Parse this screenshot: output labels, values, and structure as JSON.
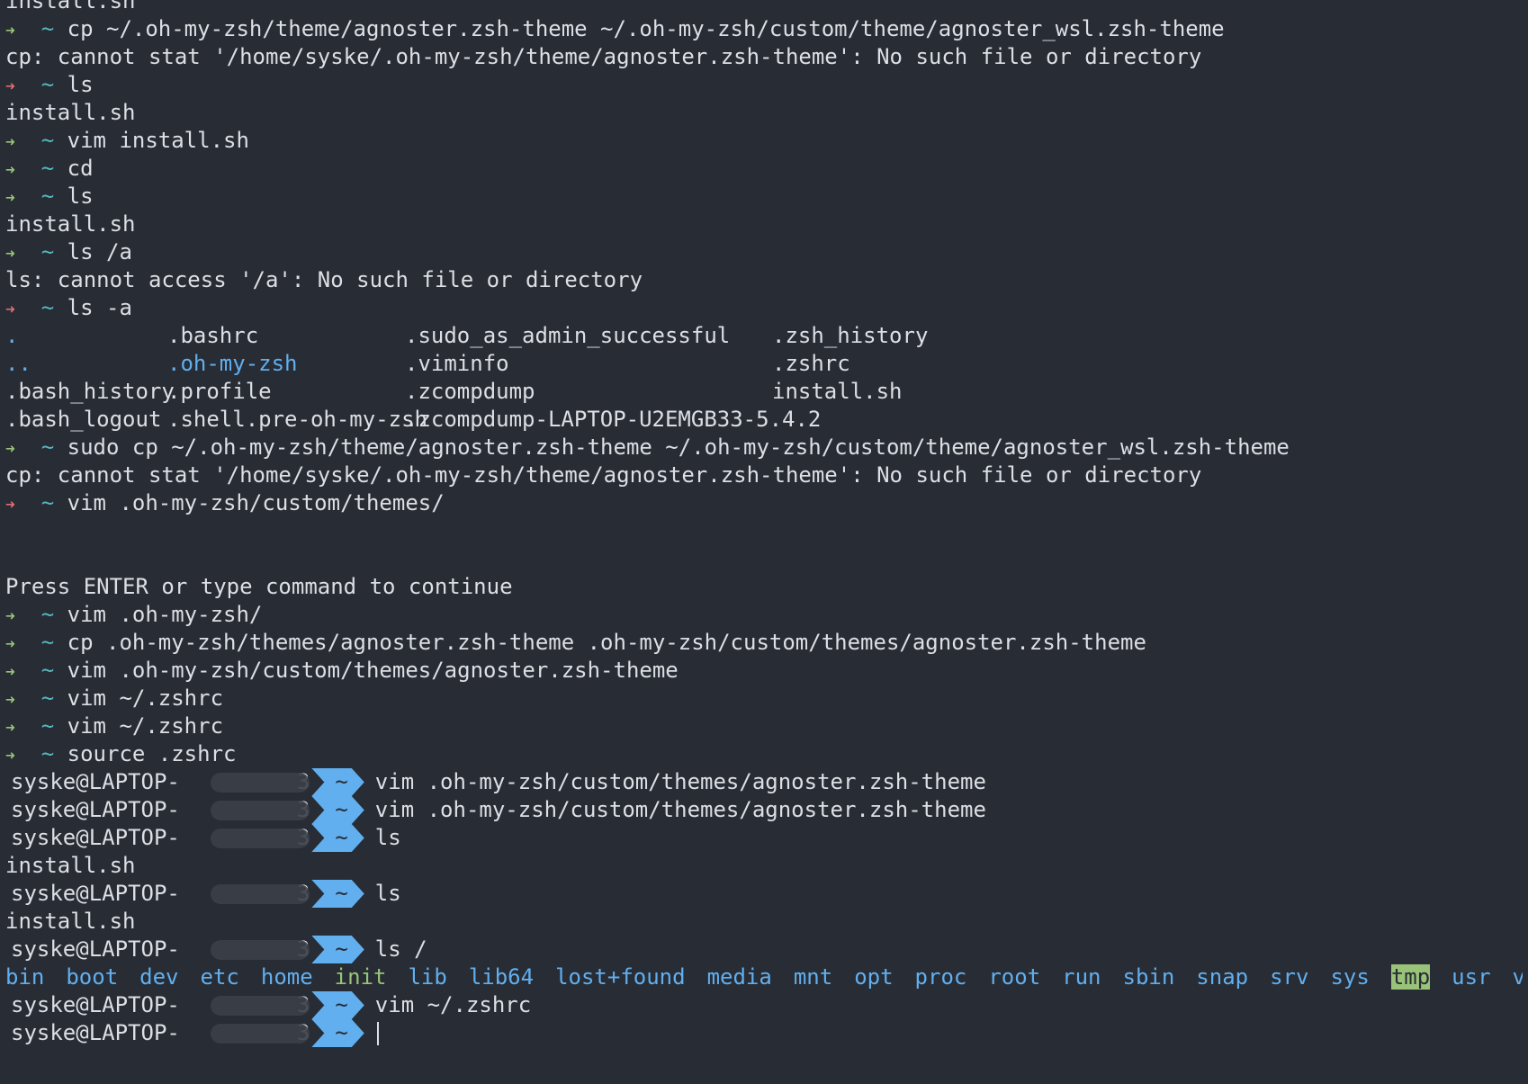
{
  "partial_top": "install.sh",
  "zsh_lines": [
    {
      "status": "ok",
      "cmd": "cp ~/.oh-my-zsh/theme/agnoster.zsh-theme ~/.oh-my-zsh/custom/theme/agnoster_wsl.zsh-theme"
    },
    {
      "out": "cp: cannot stat '/home/syske/.oh-my-zsh/theme/agnoster.zsh-theme': No such file or directory"
    },
    {
      "status": "err",
      "cmd": "ls"
    },
    {
      "out": "install.sh"
    },
    {
      "status": "ok",
      "cmd": "vim install.sh"
    },
    {
      "status": "ok",
      "cmd": "cd"
    },
    {
      "status": "ok",
      "cmd": "ls"
    },
    {
      "out": "install.sh"
    },
    {
      "status": "ok",
      "cmd": "ls /a"
    },
    {
      "out": "ls: cannot access '/a': No such file or directory"
    },
    {
      "status": "err",
      "cmd": "ls -a"
    }
  ],
  "ls_a": [
    [
      {
        "t": ".",
        "c": "dir"
      },
      {
        "t": ".bashrc"
      },
      {
        "t": ".sudo_as_admin_successful"
      },
      {
        "t": ".zsh_history"
      }
    ],
    [
      {
        "t": "..",
        "c": "dir"
      },
      {
        "t": ".oh-my-zsh",
        "c": "dir"
      },
      {
        "t": ".viminfo"
      },
      {
        "t": ".zshrc"
      }
    ],
    [
      {
        "t": ".bash_history"
      },
      {
        "t": ".profile"
      },
      {
        "t": ".zcompdump"
      },
      {
        "t": "install.sh"
      }
    ],
    [
      {
        "t": ".bash_logout"
      },
      {
        "t": ".shell.pre-oh-my-zsh"
      },
      {
        "t": ".zcompdump-LAPTOP-U2EMGB33-5.4.2"
      },
      {
        "t": ""
      }
    ]
  ],
  "zsh_lines2": [
    {
      "status": "ok",
      "cmd": "sudo cp ~/.oh-my-zsh/theme/agnoster.zsh-theme ~/.oh-my-zsh/custom/theme/agnoster_wsl.zsh-theme"
    },
    {
      "out": "cp: cannot stat '/home/syske/.oh-my-zsh/theme/agnoster.zsh-theme': No such file or directory"
    },
    {
      "status": "err",
      "cmd": "vim .oh-my-zsh/custom/themes/"
    },
    {
      "out": ""
    },
    {
      "out": ""
    },
    {
      "out": "Press ENTER or type command to continue"
    },
    {
      "status": "ok",
      "cmd": "vim .oh-my-zsh/"
    },
    {
      "status": "ok",
      "cmd": "cp .oh-my-zsh/themes/agnoster.zsh-theme .oh-my-zsh/custom/themes/agnoster.zsh-theme"
    },
    {
      "status": "ok",
      "cmd": "vim .oh-my-zsh/custom/themes/agnoster.zsh-theme"
    },
    {
      "status": "ok",
      "cmd": "vim ~/.zshrc"
    },
    {
      "status": "ok",
      "cmd": "vim ~/.zshrc"
    },
    {
      "status": "ok",
      "cmd": "source .zshrc"
    }
  ],
  "prompt_glyphs": {
    "arrow": "➜",
    "tilde": "~"
  },
  "agnoster": {
    "host": "syske@LAPTOP-",
    "host_tail": "3",
    "dir": "~",
    "lines": [
      {
        "cmd": "vim .oh-my-zsh/custom/themes/agnoster.zsh-theme"
      },
      {
        "cmd": "vim .oh-my-zsh/custom/themes/agnoster.zsh-theme"
      },
      {
        "cmd": "ls"
      },
      {
        "out": "install.sh"
      },
      {
        "cmd": "ls"
      },
      {
        "out": "install.sh"
      },
      {
        "cmd": "ls /"
      },
      {
        "dirs": [
          "bin",
          "boot",
          "dev",
          "etc",
          "home",
          "init",
          "lib",
          "lib64",
          "lost+found",
          "media",
          "mnt",
          "opt",
          "proc",
          "root",
          "run",
          "sbin",
          "snap",
          "srv",
          "sys",
          "tmp",
          "usr",
          "var"
        ]
      },
      {
        "cmd": "vim ~/.zshrc"
      },
      {
        "cmd": "",
        "cursor": true
      }
    ]
  },
  "colors": {
    "background": "#282c34",
    "foreground": "#dcdfe4",
    "ok": "#98c379",
    "err": "#e06c75",
    "dir": "#61afef"
  }
}
